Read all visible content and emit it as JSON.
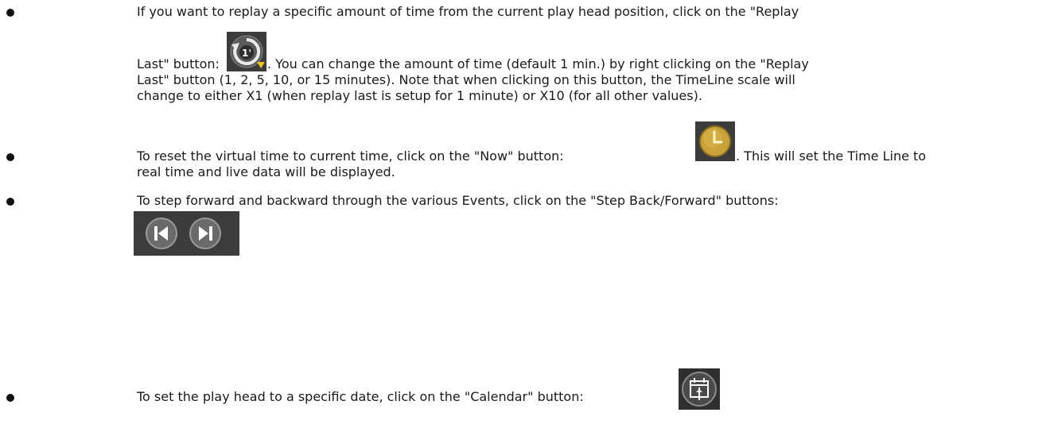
{
  "bullets": {
    "replay": {
      "line1": "If you want to replay a specific amount of time from the current play head position, click on the \"Replay",
      "line2_start": "Last\" button:",
      "line2_end": ". You can change the amount of time (default 1 min.) by right clicking on the \"Replay",
      "line3": "Last\" button (1, 2, 5, 10, or 15 minutes). Note that when clicking on this button, the TimeLine scale will",
      "line4": "change to either X1 (when replay last is setup for 1 minute) or X10 (for all other values).",
      "icon": "replay-last-icon",
      "icon_text": "1'"
    },
    "now": {
      "line1_start": "To reset the virtual time to current time, click on the \"Now\" button:",
      "line1_end": ". This will set the Time Line to",
      "line2": "real time and live data will be displayed.",
      "icon": "clock-icon"
    },
    "step": {
      "line1": "To step forward and backward through the various Events, click on the \"Step Back/Forward\" buttons:",
      "icons": [
        "step-back-icon",
        "step-forward-icon"
      ]
    },
    "calendar": {
      "line1": "To set the play head to a specific date, click on the \"Calendar\" button:",
      "icon": "calendar-icon"
    }
  },
  "colors": {
    "icon_background": "#3c3c3c",
    "clock_gold": "#c9a23a",
    "arrow_yellow": "#f0c419"
  }
}
